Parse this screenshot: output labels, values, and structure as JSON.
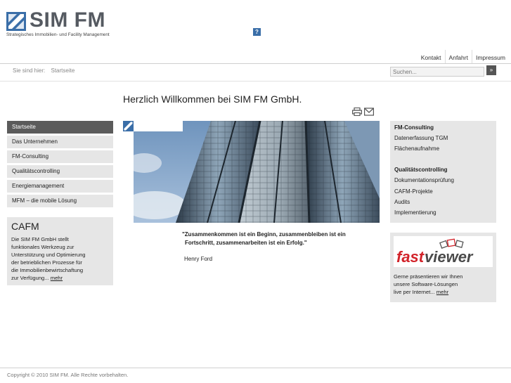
{
  "logo": {
    "name": "SIM FM",
    "tagline": "Strategisches Immobilien- und Facility Management"
  },
  "help_icon": {
    "label": "?",
    "icon": "help-icon"
  },
  "topnav": [
    "Kontakt",
    "Anfahrt",
    "Impressum"
  ],
  "breadcrumb": {
    "prefix": "Sie sind hier:",
    "current": "Startseite"
  },
  "search": {
    "placeholder": "Suchen...",
    "button": "»"
  },
  "page_title": "Herzlich Willkommen bei SIM FM GmbH.",
  "toolbar_icons": [
    "print-icon",
    "mail-icon"
  ],
  "sidebar": {
    "items": [
      {
        "label": "Startseite",
        "active": true
      },
      {
        "label": "Das Unternehmen",
        "active": false
      },
      {
        "label": "FM-Consulting",
        "active": false
      },
      {
        "label": "Qualitätscontrolling",
        "active": false
      },
      {
        "label": "Energiemanagement",
        "active": false
      },
      {
        "label": "MFM – die mobile Lösung",
        "active": false
      }
    ]
  },
  "cafm": {
    "title": "CAFM",
    "text": "Die SIM FM GmbH stellt\nfunktionales Werkzeug zur\nUnterstützung und Optimierung\nder betrieblichen Prozesse für\ndie Immobilienbewirtschaftung\nzur Verfügung...",
    "more": "mehr"
  },
  "quote": {
    "line1": "\"Zusammenkommen ist ein Beginn, zusammenbleiben ist ein",
    "line2": "Fortschritt, zusammenarbeiten ist ein Erfolg.\"",
    "author": "Henry Ford"
  },
  "right": {
    "group1_head": "FM-Consulting",
    "group1_links": [
      "Datenerfassung TGM",
      "Flächenaufnahme"
    ],
    "group2_head": "Qualitätscontrolling",
    "group2_links": [
      "Dokumentationsprüfung",
      "CAFM-Projekte",
      "Audits",
      "Implementierung"
    ]
  },
  "fastviewer": {
    "logo_text_fast": "fast",
    "logo_text_viewer": "viewer",
    "text": "Gerne präsentieren wir Ihnen\nunsere Software-Lösungen\nlive per Internet...",
    "more": "mehr"
  },
  "footer": "Copyright © 2010 SIM FM. Alle Rechte vorbehalten.",
  "colors": {
    "brand_blue": "#3a6ea8",
    "dark_nav": "#5b5b5b",
    "panel_grey": "#e6e6e6",
    "fastviewer_red": "#d2232a"
  }
}
